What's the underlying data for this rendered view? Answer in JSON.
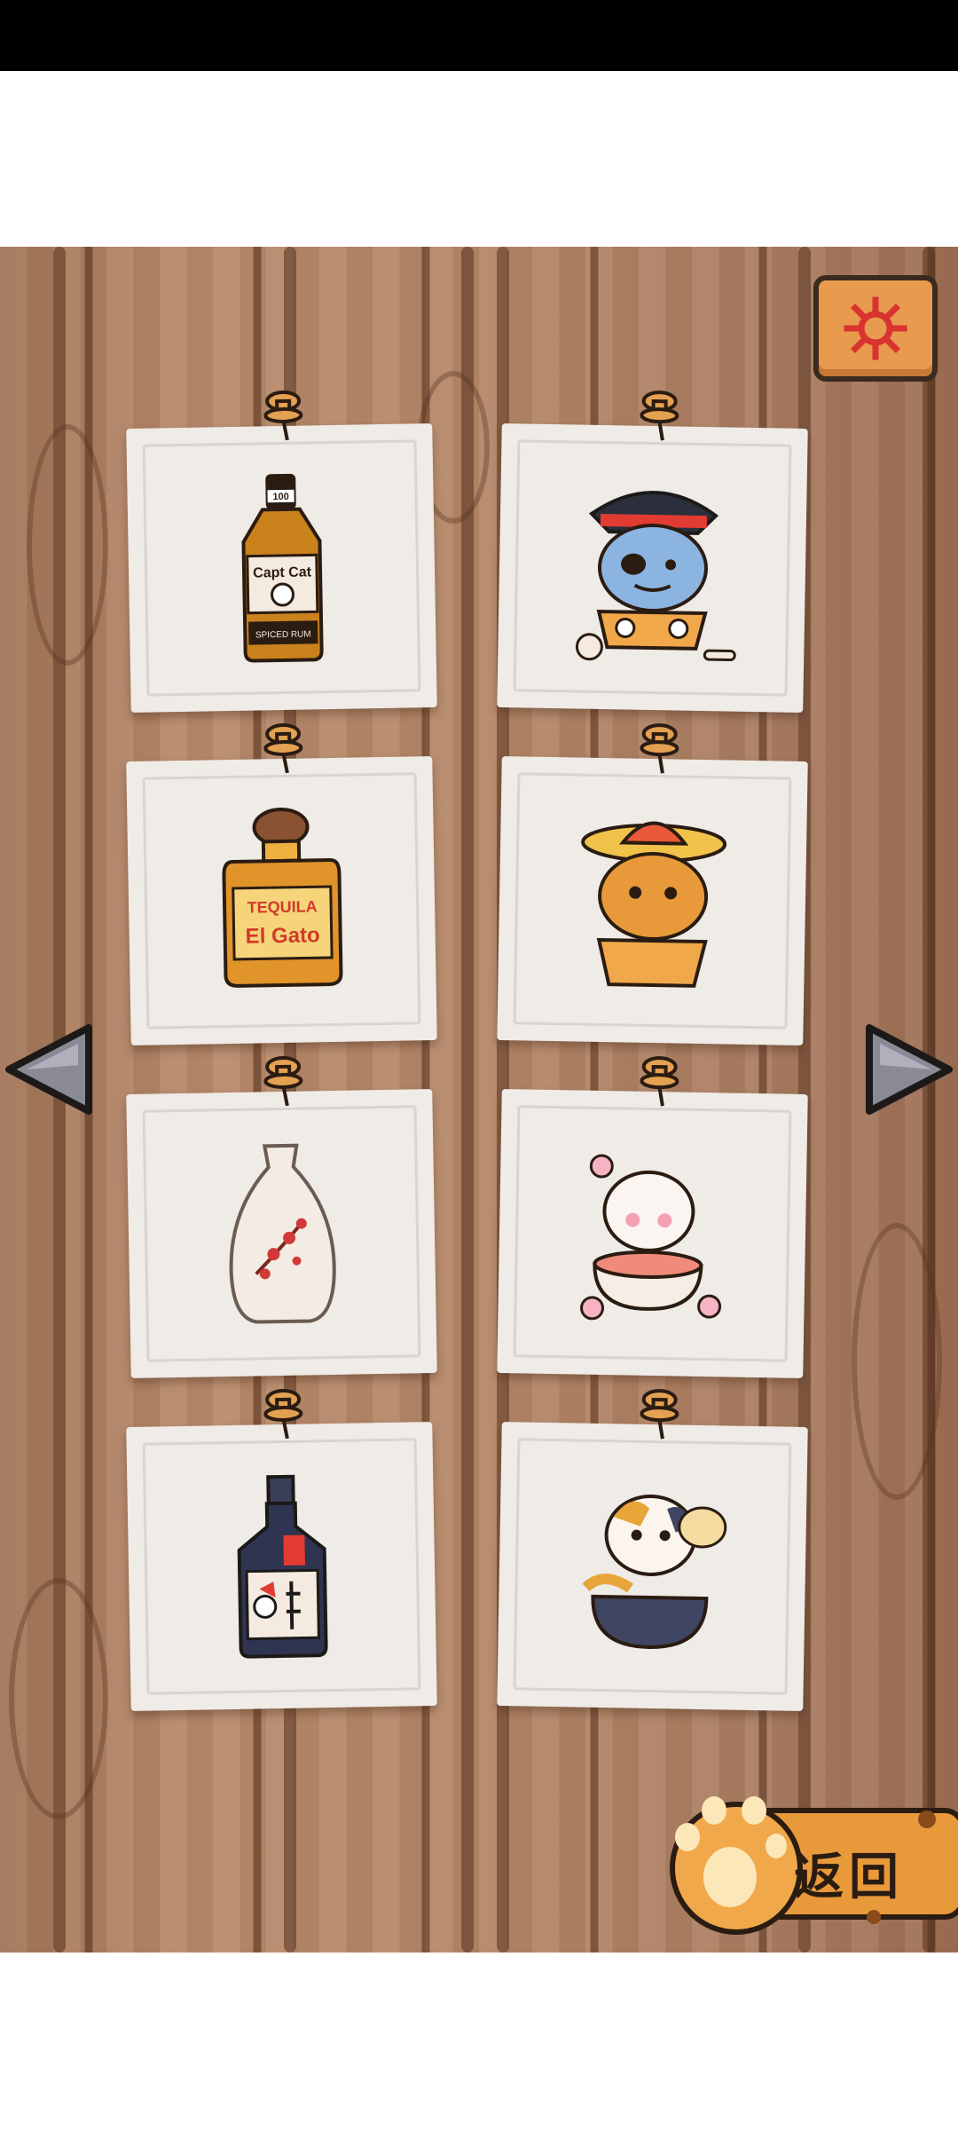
{
  "screen": {
    "background": "#b58667",
    "accent": "#e89a4e"
  },
  "toolbar": {
    "settings_icon": "gear-icon"
  },
  "navigation": {
    "prev_icon": "triangle-left-icon",
    "next_icon": "triangle-right-icon",
    "back_label": "返回",
    "back_icon": "cat-paw-icon"
  },
  "cards": [
    {
      "item": "capt-cat-rum-bottle",
      "label": "Capt Cat",
      "sublabel": "SPICED RUM",
      "badge": "100"
    },
    {
      "item": "pirate-cat-sticker"
    },
    {
      "item": "tequila-bottle",
      "label": "TEQUILA",
      "sublabel": "El Gato"
    },
    {
      "item": "sombrero-cat-sticker"
    },
    {
      "item": "sake-vase-bottle"
    },
    {
      "item": "sakura-cat-sticker"
    },
    {
      "item": "japanese-sake-bottle"
    },
    {
      "item": "calico-cat-bowl-sticker"
    }
  ]
}
